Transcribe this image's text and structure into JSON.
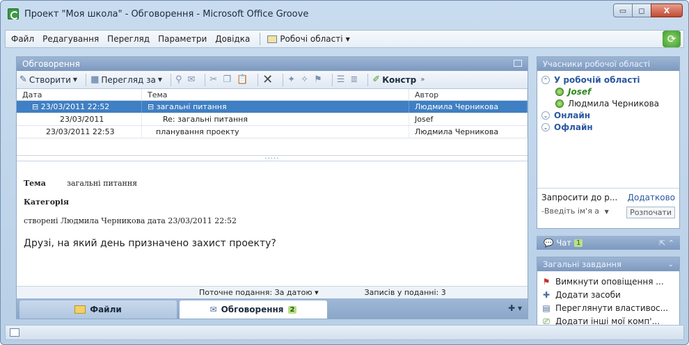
{
  "window": {
    "title": "Проект \"Моя школа\" - Обговорення - Microsoft Office Groove",
    "buttons": [
      "▭",
      "◻",
      "X"
    ]
  },
  "menubar": {
    "items": [
      "Файл",
      "Редагування",
      "Перегляд",
      "Параметри",
      "Довідка"
    ],
    "workspaces_label": "Робочі області"
  },
  "discussion": {
    "header": "Обговорення",
    "toolbar": {
      "create_label": "Створити",
      "view_by_label": "Перегляд за",
      "constr_label": "Констр"
    },
    "columns": [
      "Дата",
      "Тема",
      "Автор"
    ],
    "rows": [
      {
        "date": "⊟ 23/03/2011 22:52",
        "topic": "⊟ загальні питання",
        "author": "Людмила Черникова",
        "selected": true
      },
      {
        "date": "23/03/2011",
        "topic": "Re: загальні питання",
        "author": "Josef",
        "selected": false
      },
      {
        "date": "23/03/2011 22:53",
        "topic": "планування проекту",
        "author": "Людмила Черникова",
        "selected": false
      }
    ],
    "preview": {
      "topic_label": "Тема",
      "topic_value": "загальні питання",
      "category_label": "Категорія",
      "created_line": "створені Людмила Черникова дата 23/03/2011 22:52",
      "body": "Друзі, на який день призначено захист проекту?"
    },
    "status": {
      "current_view": "Поточне подання: За датою ▾",
      "record_count": "Записів у поданні: 3"
    },
    "tabs": {
      "files_label": "Файли",
      "discussion_label": "Обговорення",
      "discussion_badge": "2"
    }
  },
  "members": {
    "header": "Учасники робочої області",
    "in_workspace_label": "У робочій області",
    "in_workspace": [
      "Josef",
      "Людмила Черникова"
    ],
    "online_label": "Онлайн",
    "offline_label": "Офлайн",
    "invite_label": "Запросити до р...",
    "more_label": "Додатково",
    "name_placeholder": "-Введіть ім'я а",
    "start_button": "Розпочати"
  },
  "chat": {
    "label": "Чат",
    "badge": "1"
  },
  "tasks": {
    "header": "Загальні завдання",
    "items": [
      "Вимкнути оповіщення ...",
      "Додати засоби",
      "Переглянути властивос...",
      "Додати інші мої комп'..."
    ]
  }
}
